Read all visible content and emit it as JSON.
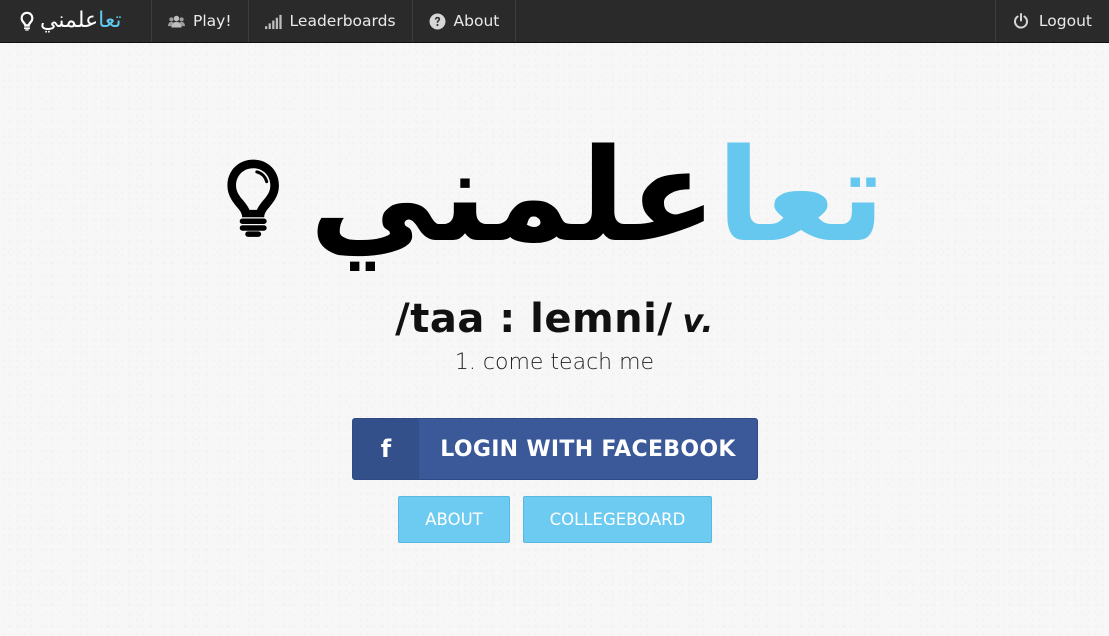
{
  "brand": {
    "logo_blue": "تعا",
    "logo_black": "علمني"
  },
  "nav": {
    "play": "Play!",
    "leaderboards": "Leaderboards",
    "about": "About",
    "logout": "Logout"
  },
  "hero": {
    "logo_blue": "تعا",
    "logo_black": "علمني",
    "pronunciation": "/taa : lemni/",
    "part_of_speech": "v.",
    "definition": "1. come teach me"
  },
  "buttons": {
    "facebook_icon": "f",
    "facebook_login": "LOGIN WITH FACEBOOK",
    "about": "ABOUT",
    "collegeboard": "COLLEGEBOARD"
  },
  "colors": {
    "navbar": "#2a2a2a",
    "accent_blue": "#66c8ef",
    "facebook": "#3b5998",
    "light_button": "#6dcbf1"
  },
  "icons": {
    "brand": "lightbulb-icon",
    "play": "users-icon",
    "leaderboards": "signal-bars-icon",
    "about": "question-circle-icon",
    "logout": "power-icon",
    "hero": "lightbulb-icon"
  }
}
